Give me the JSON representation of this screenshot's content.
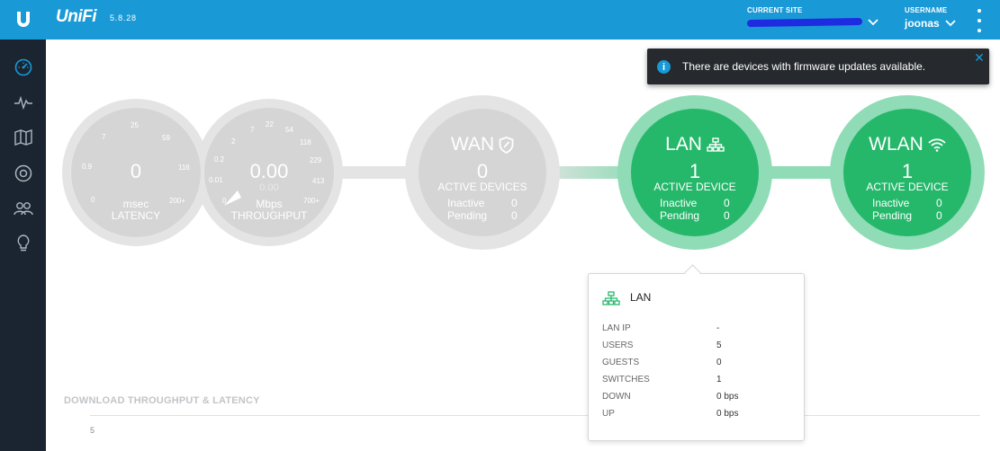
{
  "header": {
    "brand": "UniFi",
    "version": "5.8.28",
    "current_site_label": "CURRENT SITE",
    "username_label": "USERNAME",
    "username": "joonas"
  },
  "sidebar": {
    "items": [
      {
        "name": "dashboard",
        "icon": "dashboard-icon",
        "active": true
      },
      {
        "name": "statistics",
        "icon": "pulse-icon"
      },
      {
        "name": "map",
        "icon": "map-icon"
      },
      {
        "name": "devices",
        "icon": "device-icon"
      },
      {
        "name": "clients",
        "icon": "users-icon"
      },
      {
        "name": "insights",
        "icon": "lightbulb-icon"
      }
    ]
  },
  "notification": {
    "text": "There are devices with firmware updates available."
  },
  "latency": {
    "value": "0",
    "unit": "msec",
    "label": "LATENCY",
    "scale": [
      "0",
      "0.9",
      "7",
      "25",
      "59",
      "116",
      "200+"
    ]
  },
  "throughput": {
    "value": "0.00",
    "secondary": "0.00",
    "unit": "Mbps",
    "label": "THROUGHPUT",
    "scale": [
      "0",
      "0.01",
      "0.2",
      "2",
      "7",
      "22",
      "54",
      "118",
      "229",
      "413",
      "700+"
    ]
  },
  "wan": {
    "title": "WAN",
    "count": "0",
    "subtitle": "ACTIVE DEVICES",
    "inactive_label": "Inactive",
    "inactive": "0",
    "pending_label": "Pending",
    "pending": "0"
  },
  "lan": {
    "title": "LAN",
    "count": "1",
    "subtitle": "ACTIVE DEVICE",
    "inactive_label": "Inactive",
    "inactive": "0",
    "pending_label": "Pending",
    "pending": "0"
  },
  "wlan": {
    "title": "WLAN",
    "count": "1",
    "subtitle": "ACTIVE DEVICE",
    "inactive_label": "Inactive",
    "inactive": "0",
    "pending_label": "Pending",
    "pending": "0"
  },
  "lan_popup": {
    "title": "LAN",
    "rows": [
      {
        "label": "LAN IP",
        "value": "-"
      },
      {
        "label": "USERS",
        "value": "5"
      },
      {
        "label": "GUESTS",
        "value": "0"
      },
      {
        "label": "SWITCHES",
        "value": "1"
      },
      {
        "label": "DOWN",
        "value": "0 bps"
      },
      {
        "label": "UP",
        "value": "0 bps"
      }
    ]
  },
  "chart": {
    "title": "DOWNLOAD THROUGHPUT & LATENCY",
    "y_top": "5"
  },
  "colors": {
    "topbar": "#1999d6",
    "sidebar": "#1b2532",
    "green": "#25b86b",
    "green_light": "#8fdcb6",
    "gray": "#d5d5d5",
    "gray_light": "#e4e4e4"
  }
}
